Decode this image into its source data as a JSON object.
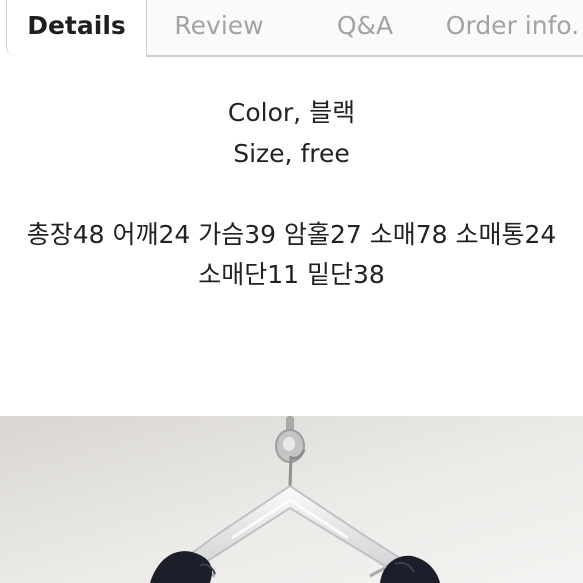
{
  "tabs": [
    {
      "label": "Details",
      "active": true
    },
    {
      "label": "Review",
      "active": false
    },
    {
      "label": "Q&A",
      "active": false
    },
    {
      "label": "Order info.",
      "active": false
    }
  ],
  "description": {
    "color_line": "Color, 블랙",
    "size_line": "Size, free",
    "measure_line1": "총장48 어깨24 가슴39 암홀27 소매78 소매통24",
    "measure_line2": "소매단11 밑단38"
  },
  "colors": {
    "active_tab_text": "#1f1f1f",
    "inactive_tab_text": "#a3a3a3",
    "border": "#cfcfcf"
  },
  "product_photo": {
    "subject": "black garment on clear plastic hanger hanging from wall hook"
  }
}
